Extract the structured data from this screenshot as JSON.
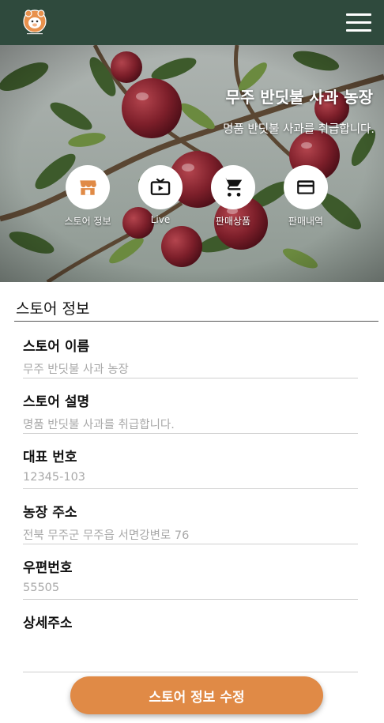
{
  "header": {
    "logo_icon": "farm-logo-icon",
    "menu_icon": "hamburger-menu-icon",
    "bar_color": "#2f4a3d"
  },
  "hero": {
    "title": "무주 반딧불 사과 농장",
    "subtitle": "명품 반딧불 사과를 취급합니다."
  },
  "nav": [
    {
      "label": "스토어 정보",
      "icon": "store-icon",
      "color": "#e08a46"
    },
    {
      "label": "Live",
      "icon": "tv-play-icon"
    },
    {
      "label": "판매상품",
      "icon": "cart-icon"
    },
    {
      "label": "판매내역",
      "icon": "credit-card-icon"
    }
  ],
  "section": {
    "title": "스토어 정보"
  },
  "fields": [
    {
      "label": "스토어 이름",
      "value": "무주 반딧불 사과 농장"
    },
    {
      "label": "스토어 설명",
      "value": "명품 반딧불 사과를 취급합니다."
    },
    {
      "label": "대표 번호",
      "value": "12345-103"
    },
    {
      "label": "농장 주소",
      "value": "전북 무주군 무주읍 서면강변로 76"
    },
    {
      "label": "우편번호",
      "value": "55505"
    },
    {
      "label": "상세주소",
      "value": ""
    }
  ],
  "button": {
    "label": "스토어 정보 수정",
    "color": "#e08a46"
  }
}
